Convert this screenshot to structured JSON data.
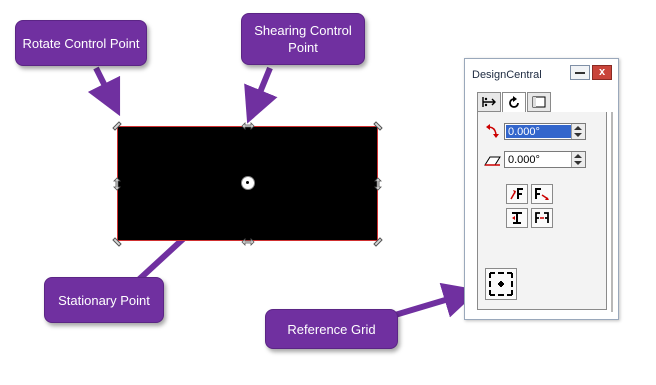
{
  "callouts": {
    "rotate": "Rotate Control Point",
    "shearing": "Shearing Control Point",
    "stationary": "Stationary Point",
    "reference_grid": "Reference Grid"
  },
  "panel": {
    "title": "DesignCentral",
    "close_label": "x",
    "tabs": [
      {
        "icon": "move-tab-icon"
      },
      {
        "icon": "rotate-tab-icon"
      },
      {
        "icon": "scale-tab-icon"
      }
    ],
    "active_tab": 1,
    "rotate_angle": "0.000°",
    "shear_angle": "0.000°",
    "buttons": [
      "rotate-90-left-icon",
      "rotate-90-right-icon",
      "flip-vertical-icon",
      "flip-horizontal-icon"
    ]
  },
  "colors": {
    "callout": "#7030a0",
    "shape_fill": "#000000",
    "shape_outline": "#d03030",
    "selection": "#3366cc"
  }
}
